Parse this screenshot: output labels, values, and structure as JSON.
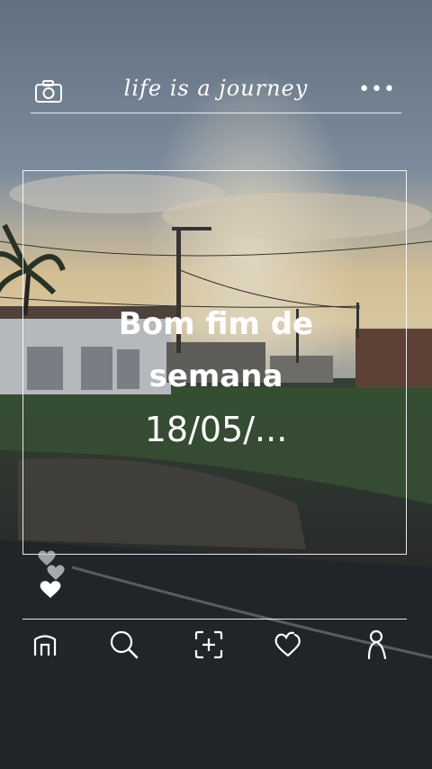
{
  "header": {
    "title": "life is a journey"
  },
  "post": {
    "caption_line1": "Bom fim de",
    "caption_line2": "semana",
    "caption_date": "18/05/..."
  },
  "icons": {
    "top_left": "camera-icon",
    "top_right": "more-icon",
    "likes": "hearts-icon",
    "nav": [
      "home-icon",
      "search-icon",
      "add-post-icon",
      "heart-icon",
      "profile-icon"
    ]
  }
}
